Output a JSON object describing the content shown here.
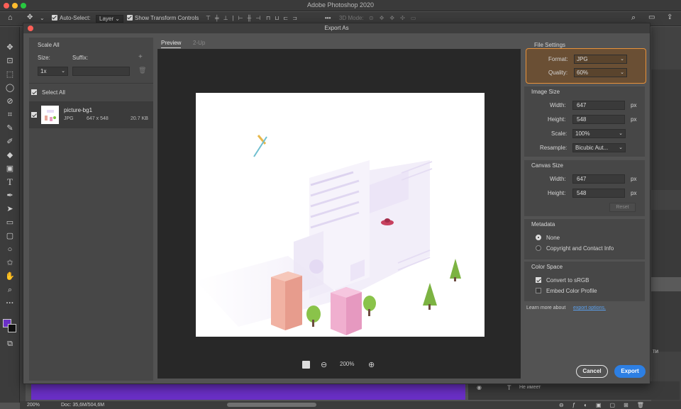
{
  "app": {
    "window_title": "Adobe Photoshop 2020",
    "traffic_lights": [
      "#ff5f57",
      "#febc2e",
      "#28c840"
    ],
    "accent": "#2d7fe3",
    "highlight_border": "#e8923a"
  },
  "options_bar": {
    "auto_select_label": "Auto-Select:",
    "auto_select_target": "Layer",
    "show_transform_label": "Show Transform Controls",
    "mode_3d_label": "3D Mode:"
  },
  "status_bar": {
    "zoom": "200%",
    "doc": "Doc: 35,6M/504,6M"
  },
  "layers_panel": {
    "row_label": "Не имеет",
    "cut_text": "ти"
  },
  "dialog": {
    "title": "Export As",
    "scale_all": {
      "title": "Scale All",
      "size_label": "Size:",
      "suffix_label": "Suffix:",
      "size_value": "1x",
      "suffix_placeholder": ""
    },
    "select_all_label": "Select All",
    "assets": [
      {
        "name": "picture-bg1",
        "format": "JPG",
        "dimensions": "647 x 548",
        "size": "20.7 KB"
      }
    ],
    "tabs": [
      "Preview",
      "2-Up"
    ],
    "zoom": {
      "value": "200%"
    },
    "file_settings": {
      "title": "File Settings",
      "format_label": "Format:",
      "format_value": "JPG",
      "quality_label": "Quality:",
      "quality_value": "60%"
    },
    "image_size": {
      "title": "Image Size",
      "width_label": "Width:",
      "width_value": "647",
      "height_label": "Height:",
      "height_value": "548",
      "unit": "px",
      "scale_label": "Scale:",
      "scale_value": "100%",
      "resample_label": "Resample:",
      "resample_value": "Bicubic Aut..."
    },
    "canvas_size": {
      "title": "Canvas Size",
      "width_label": "Width:",
      "width_value": "647",
      "height_label": "Height:",
      "height_value": "548",
      "unit": "px",
      "reset_label": "Reset"
    },
    "metadata": {
      "title": "Metadata",
      "options": [
        "None",
        "Copyright and Contact Info"
      ],
      "selected": "None"
    },
    "color_space": {
      "title": "Color Space",
      "convert_label": "Convert to sRGB",
      "convert_checked": true,
      "embed_label": "Embed Color Profile",
      "embed_checked": false
    },
    "learn_more_text": "Learn more about",
    "learn_more_link": "export options.",
    "cancel_label": "Cancel",
    "export_label": "Export"
  }
}
